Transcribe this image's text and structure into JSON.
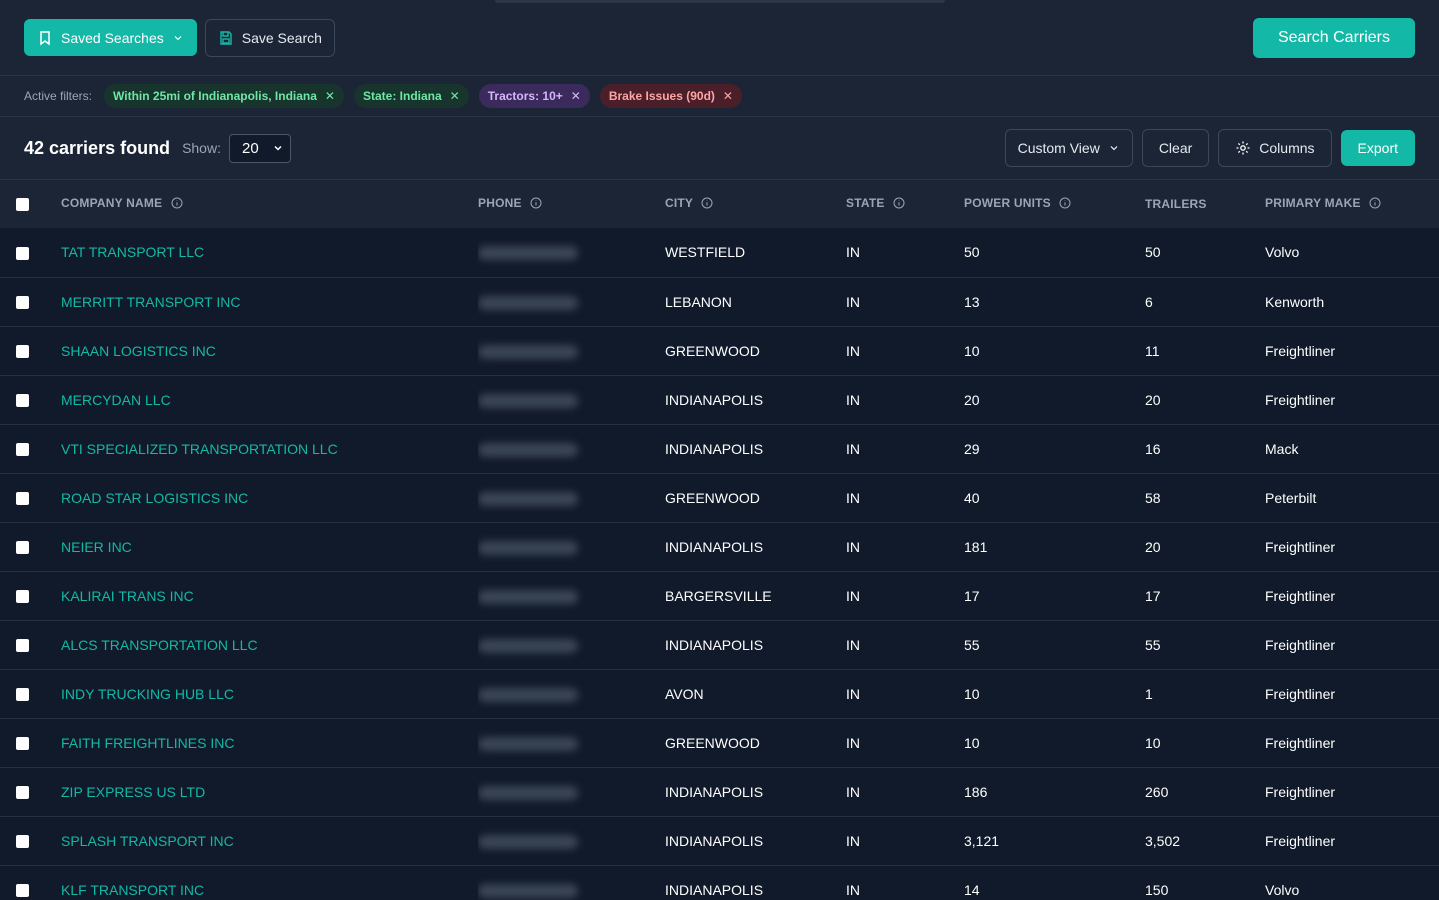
{
  "topbar": {
    "saved_searches_label": "Saved Searches",
    "save_search_label": "Save Search",
    "search_carriers_label": "Search Carriers"
  },
  "filters": {
    "label": "Active filters:",
    "chips": [
      {
        "text": "Within 25mi of Indianapolis, Indiana",
        "color": "green"
      },
      {
        "text": "State: Indiana",
        "color": "green"
      },
      {
        "text": "Tractors: 10+",
        "color": "purple"
      },
      {
        "text": "Brake Issues (90d)",
        "color": "red"
      }
    ]
  },
  "results": {
    "count_text": "42 carriers found",
    "show_label": "Show:",
    "page_size": "20",
    "custom_view_label": "Custom View",
    "clear_label": "Clear",
    "columns_label": "Columns",
    "export_label": "Export"
  },
  "table": {
    "headers": {
      "company": "COMPANY NAME",
      "phone": "PHONE",
      "city": "CITY",
      "state": "STATE",
      "power_units": "POWER UNITS",
      "trailers": "TRAILERS",
      "primary_make": "PRIMARY MAKE"
    },
    "rows": [
      {
        "company": "TAT TRANSPORT LLC",
        "city": "WESTFIELD",
        "state": "IN",
        "power_units": "50",
        "trailers": "50",
        "make": "Volvo"
      },
      {
        "company": "MERRITT TRANSPORT INC",
        "city": "LEBANON",
        "state": "IN",
        "power_units": "13",
        "trailers": "6",
        "make": "Kenworth"
      },
      {
        "company": "SHAAN LOGISTICS INC",
        "city": "GREENWOOD",
        "state": "IN",
        "power_units": "10",
        "trailers": "11",
        "make": "Freightliner"
      },
      {
        "company": "MERCYDAN LLC",
        "city": "INDIANAPOLIS",
        "state": "IN",
        "power_units": "20",
        "trailers": "20",
        "make": "Freightliner"
      },
      {
        "company": "VTI SPECIALIZED TRANSPORTATION LLC",
        "city": "INDIANAPOLIS",
        "state": "IN",
        "power_units": "29",
        "trailers": "16",
        "make": "Mack"
      },
      {
        "company": "ROAD STAR LOGISTICS INC",
        "city": "GREENWOOD",
        "state": "IN",
        "power_units": "40",
        "trailers": "58",
        "make": "Peterbilt"
      },
      {
        "company": "NEIER INC",
        "city": "INDIANAPOLIS",
        "state": "IN",
        "power_units": "181",
        "trailers": "20",
        "make": "Freightliner"
      },
      {
        "company": "KALIRAI TRANS INC",
        "city": "BARGERSVILLE",
        "state": "IN",
        "power_units": "17",
        "trailers": "17",
        "make": "Freightliner"
      },
      {
        "company": "ALCS TRANSPORTATION LLC",
        "city": "INDIANAPOLIS",
        "state": "IN",
        "power_units": "55",
        "trailers": "55",
        "make": "Freightliner"
      },
      {
        "company": "INDY TRUCKING HUB LLC",
        "city": "AVON",
        "state": "IN",
        "power_units": "10",
        "trailers": "1",
        "make": "Freightliner"
      },
      {
        "company": "FAITH FREIGHTLINES INC",
        "city": "GREENWOOD",
        "state": "IN",
        "power_units": "10",
        "trailers": "10",
        "make": "Freightliner"
      },
      {
        "company": "ZIP EXPRESS US LTD",
        "city": "INDIANAPOLIS",
        "state": "IN",
        "power_units": "186",
        "trailers": "260",
        "make": "Freightliner"
      },
      {
        "company": "SPLASH TRANSPORT INC",
        "city": "INDIANAPOLIS",
        "state": "IN",
        "power_units": "3,121",
        "trailers": "3,502",
        "make": "Freightliner"
      },
      {
        "company": "KLF TRANSPORT INC",
        "city": "INDIANAPOLIS",
        "state": "IN",
        "power_units": "14",
        "trailers": "150",
        "make": "Volvo"
      }
    ]
  }
}
